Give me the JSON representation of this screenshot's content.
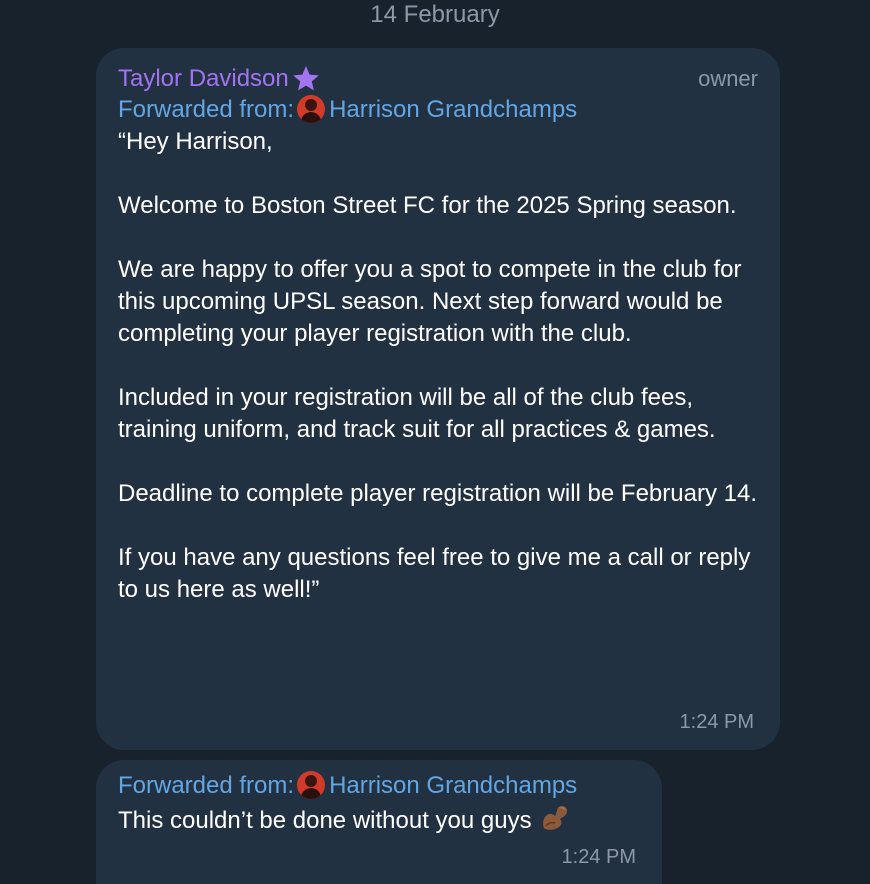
{
  "date_separator": "14 February",
  "messages": [
    {
      "sender": "Taylor Davidson",
      "sender_badge_icon": "star-icon",
      "role": "owner",
      "forwarded_label": "Forwarded from:",
      "forwarded_from": "Harrison Grandchamps",
      "text": "“Hey Harrison,\n\nWelcome to Boston Street FC for the 2025 Spring season.\n\nWe are happy to offer you a spot to compete in the club for this upcoming UPSL season. Next step forward would be completing your player registration with the club.\n\nIncluded in your registration will be all of the club fees, training uniform, and track suit for all practices & games.\n\nDeadline to complete player registration will be February 14.\n\nIf you have any questions feel free to give me a call or reply to us here as well!”",
      "time": "1:24 PM"
    },
    {
      "forwarded_label": "Forwarded from:",
      "forwarded_from": "Harrison Grandchamps",
      "text": "This couldn’t be done without you guys",
      "emoji_icon": "flexed-biceps-icon",
      "time": "1:24 PM"
    }
  ],
  "colors": {
    "background": "#18222d",
    "bubble": "#223142",
    "sender_name": "#a374f1",
    "forward_link": "#63a6e3",
    "muted": "#8c98a6"
  }
}
